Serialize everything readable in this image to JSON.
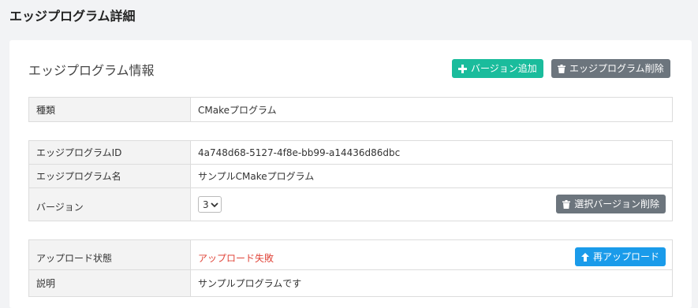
{
  "page": {
    "title": "エッジプログラム詳細"
  },
  "card": {
    "title": "エッジプログラム情報",
    "buttons": {
      "add_version": "バージョン追加",
      "delete_program": "エッジプログラム削除"
    }
  },
  "type_table": {
    "type_label": "種類",
    "type_value": "CMakeプログラム"
  },
  "detail_table": {
    "id_label": "エッジプログラムID",
    "id_value": "4a748d68-5127-4f8e-bb99-a14436d86dbc",
    "name_label": "エッジプログラム名",
    "name_value": "サンプルCMakeプログラム",
    "version_label": "バージョン",
    "version_selected": "3",
    "delete_version_button": "選択バージョン削除"
  },
  "upload_table": {
    "status_label": "アップロード状態",
    "status_value": "アップロード失敗",
    "reupload_button": "再アップロード",
    "description_label": "説明",
    "description_value": "サンプルプログラムです"
  },
  "colors": {
    "teal": "#1abc9c",
    "gray": "#6c757d",
    "blue": "#1a9bea",
    "error": "#e0453a"
  },
  "icons": [
    "plus-icon",
    "trash-icon",
    "chevron-down-icon",
    "upload-arrow-icon"
  ]
}
